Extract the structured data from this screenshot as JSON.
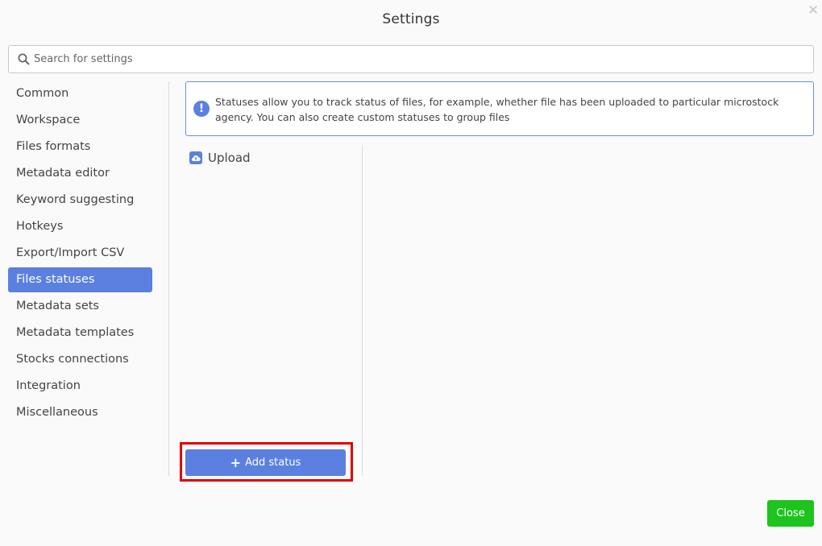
{
  "dialog": {
    "title": "Settings",
    "close_icon": "close-icon"
  },
  "search": {
    "placeholder": "Search for settings",
    "value": "",
    "icon": "search-icon"
  },
  "sidebar": {
    "items": [
      {
        "label": "Common",
        "active": false
      },
      {
        "label": "Workspace",
        "active": false
      },
      {
        "label": "Files formats",
        "active": false
      },
      {
        "label": "Metadata editor",
        "active": false
      },
      {
        "label": "Keyword suggesting",
        "active": false
      },
      {
        "label": "Hotkeys",
        "active": false
      },
      {
        "label": "Export/Import CSV",
        "active": false
      },
      {
        "label": "Files statuses",
        "active": true
      },
      {
        "label": "Metadata sets",
        "active": false
      },
      {
        "label": "Metadata templates",
        "active": false
      },
      {
        "label": "Stocks connections",
        "active": false
      },
      {
        "label": "Integration",
        "active": false
      },
      {
        "label": "Miscellaneous",
        "active": false
      }
    ]
  },
  "info": {
    "icon": "exclamation-icon",
    "text": "Statuses allow you to track status of files, for example, whether file has been uploaded to particular microstock agency. You can also create custom statuses to group files"
  },
  "statuses": [
    {
      "label": "Upload",
      "icon": "cloud-upload-icon"
    }
  ],
  "buttons": {
    "add_status": "Add status",
    "close": "Close"
  },
  "colors": {
    "accent": "#5b80e0",
    "close_button": "#1ec31e",
    "highlight": "#e00000"
  }
}
